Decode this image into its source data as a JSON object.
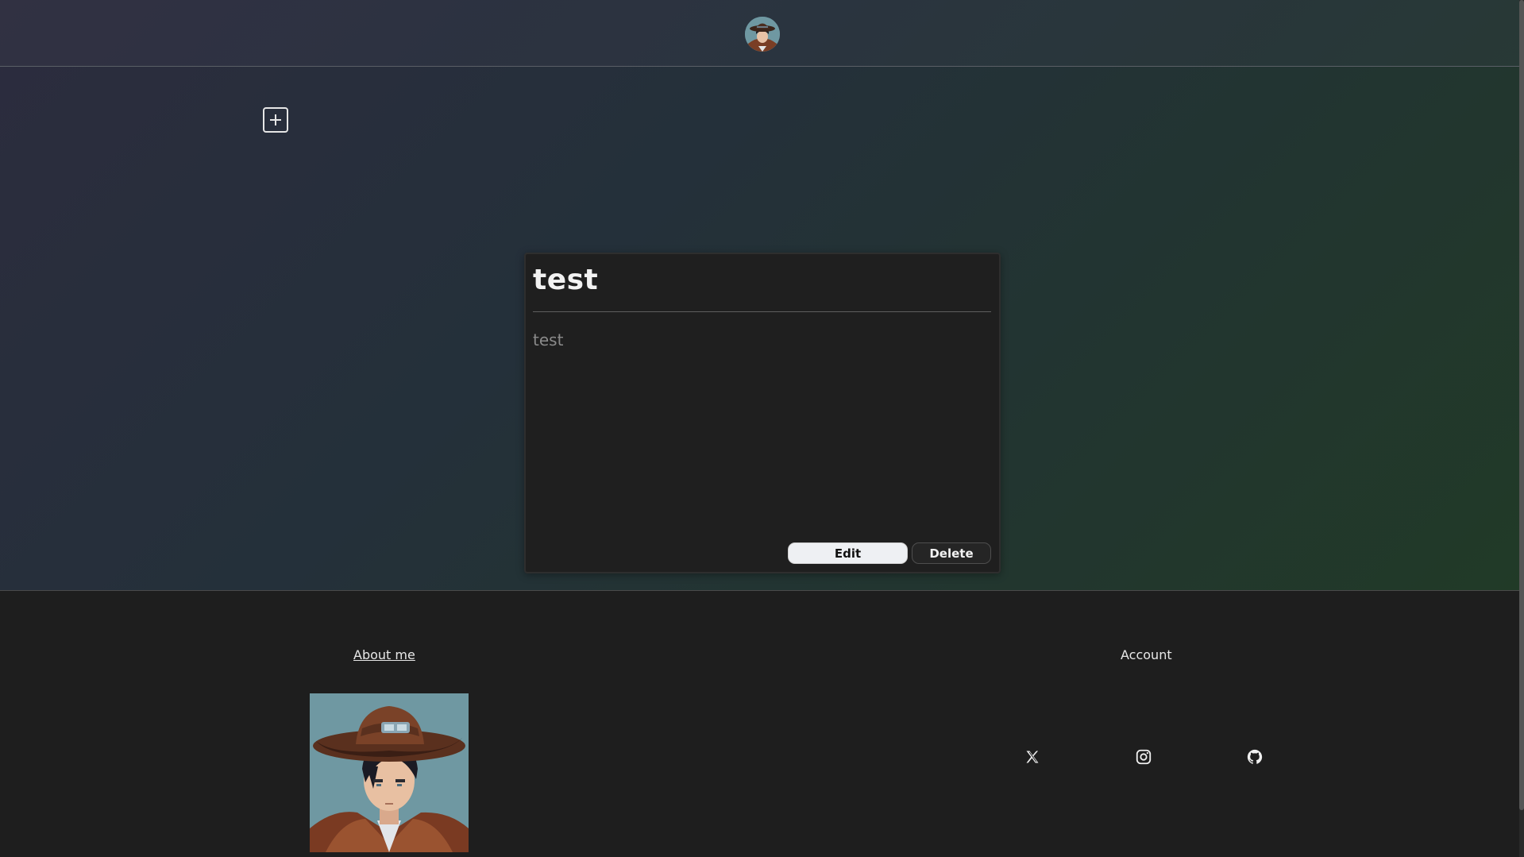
{
  "header": {
    "avatar_icon": "user-avatar-icon"
  },
  "toolbar": {
    "add_note_icon": "plus-square-icon"
  },
  "note": {
    "title": "test",
    "body": "test",
    "edit_label": "Edit",
    "delete_label": "Delete"
  },
  "footer": {
    "about_label": "About me",
    "account_label": "Account",
    "portrait_icon": "cowboy-portrait-image",
    "social_icons": [
      "x-icon",
      "instagram-icon",
      "github-icon"
    ]
  },
  "colors": {
    "card_bg": "#1f1f1f",
    "footer_bg": "#1e1e1e",
    "edit_button_bg": "#eef0f3",
    "hero_gradient_start": "#2c2c3e",
    "hero_gradient_end": "#213a27"
  }
}
